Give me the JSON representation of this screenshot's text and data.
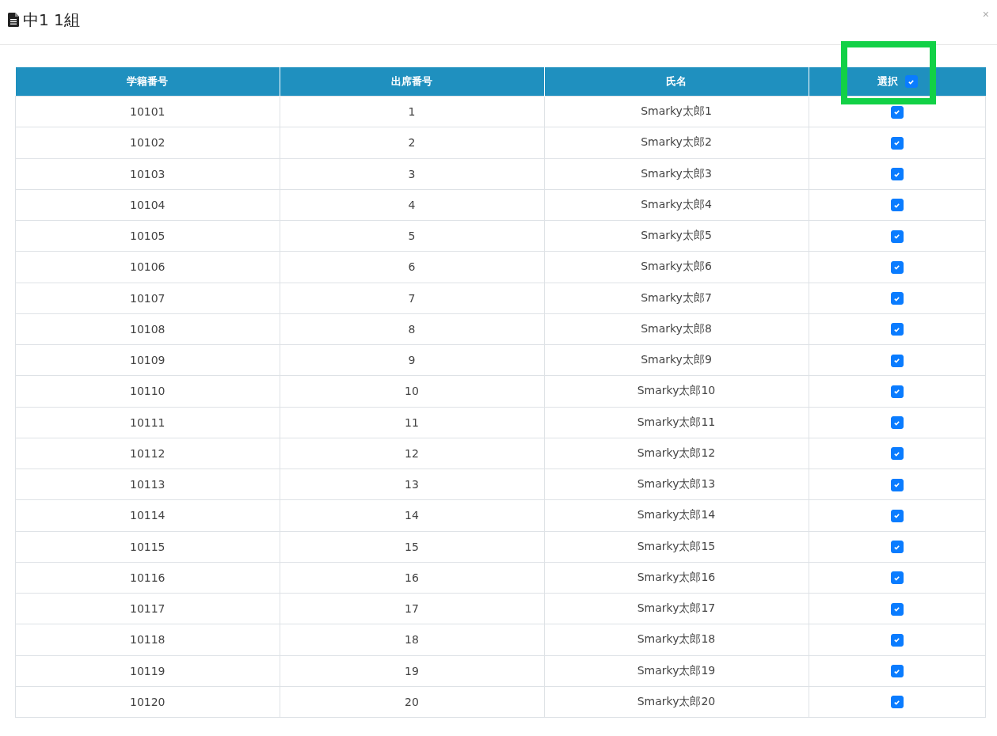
{
  "dialog": {
    "title": "中1 1組",
    "close": "×"
  },
  "table": {
    "columns": [
      {
        "label": "学籍番号",
        "kind": "text",
        "highlighted": false
      },
      {
        "label": "出席番号",
        "kind": "text",
        "highlighted": false
      },
      {
        "label": "氏名",
        "kind": "text",
        "highlighted": false
      },
      {
        "label": "選択",
        "kind": "check",
        "checked": true,
        "highlighted": true
      }
    ],
    "rows": [
      {
        "id": "10101",
        "no": "1",
        "name": "Smarky太郎1",
        "checked": true
      },
      {
        "id": "10102",
        "no": "2",
        "name": "Smarky太郎2",
        "checked": true
      },
      {
        "id": "10103",
        "no": "3",
        "name": "Smarky太郎3",
        "checked": true
      },
      {
        "id": "10104",
        "no": "4",
        "name": "Smarky太郎4",
        "checked": true
      },
      {
        "id": "10105",
        "no": "5",
        "name": "Smarky太郎5",
        "checked": true
      },
      {
        "id": "10106",
        "no": "6",
        "name": "Smarky太郎6",
        "checked": true
      },
      {
        "id": "10107",
        "no": "7",
        "name": "Smarky太郎7",
        "checked": true
      },
      {
        "id": "10108",
        "no": "8",
        "name": "Smarky太郎8",
        "checked": true
      },
      {
        "id": "10109",
        "no": "9",
        "name": "Smarky太郎9",
        "checked": true
      },
      {
        "id": "10110",
        "no": "10",
        "name": "Smarky太郎10",
        "checked": true
      },
      {
        "id": "10111",
        "no": "11",
        "name": "Smarky太郎11",
        "checked": true
      },
      {
        "id": "10112",
        "no": "12",
        "name": "Smarky太郎12",
        "checked": true
      },
      {
        "id": "10113",
        "no": "13",
        "name": "Smarky太郎13",
        "checked": true
      },
      {
        "id": "10114",
        "no": "14",
        "name": "Smarky太郎14",
        "checked": true
      },
      {
        "id": "10115",
        "no": "15",
        "name": "Smarky太郎15",
        "checked": true
      },
      {
        "id": "10116",
        "no": "16",
        "name": "Smarky太郎16",
        "checked": true
      },
      {
        "id": "10117",
        "no": "17",
        "name": "Smarky太郎17",
        "checked": true
      },
      {
        "id": "10118",
        "no": "18",
        "name": "Smarky太郎18",
        "checked": true
      },
      {
        "id": "10119",
        "no": "19",
        "name": "Smarky太郎19",
        "checked": true
      },
      {
        "id": "10120",
        "no": "20",
        "name": "Smarky太郎20",
        "checked": true
      }
    ]
  }
}
